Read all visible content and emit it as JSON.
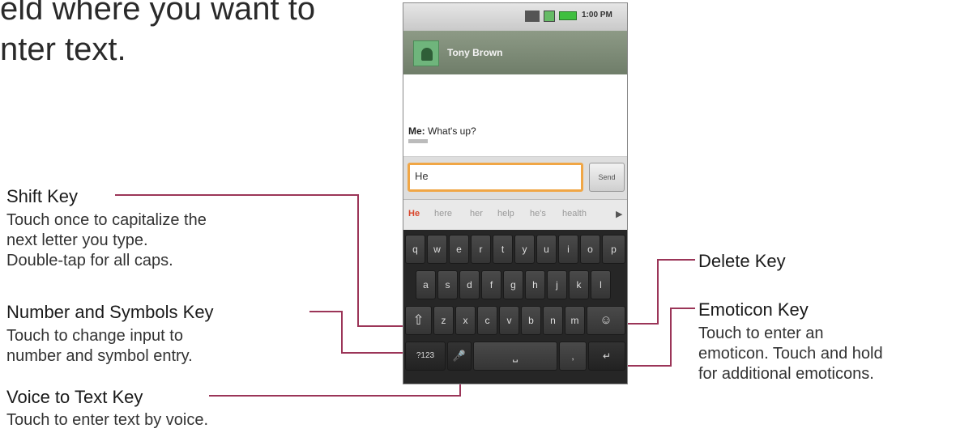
{
  "intro_text": "eld where you want to\nnter text.",
  "annotations": {
    "shift": {
      "title": "Shift Key",
      "desc": "Touch once to capitalize the\nnext letter you type.\nDouble-tap for all caps."
    },
    "number_symbols": {
      "title": "Number and Symbols Key",
      "desc": "Touch to change input to\nnumber and symbol entry."
    },
    "voice": {
      "title": "Voice to Text Key",
      "desc": "Touch to enter text by voice."
    },
    "delete": {
      "title": "Delete Key"
    },
    "emoticon": {
      "title": "Emoticon Key",
      "desc": "Touch to enter an\nemoticon. Touch and hold\nfor additional emoticons."
    }
  },
  "phone": {
    "status_time": "1:00 PM",
    "contact_name": "Tony Brown",
    "message": {
      "sender": "Me:",
      "text": "What's up?"
    },
    "input_value": "He",
    "send_label": "Send",
    "suggestions": [
      "He",
      "here",
      "her",
      "help",
      "he's",
      "health"
    ],
    "more_glyph": "▶",
    "keys": {
      "row1": [
        "q",
        "w",
        "e",
        "r",
        "t",
        "y",
        "u",
        "i",
        "o",
        "p"
      ],
      "row2": [
        "a",
        "s",
        "d",
        "f",
        "g",
        "h",
        "j",
        "k",
        "l"
      ],
      "row3": [
        "z",
        "x",
        "c",
        "v",
        "b",
        "n",
        "m"
      ],
      "shift_glyph": "⇧",
      "emoticon_glyph": "☺",
      "number_key": "?123",
      "mic_glyph": "🎤",
      "space_glyph": "⎵",
      "comma": ",",
      "enter_glyph": "↵"
    }
  },
  "colors": {
    "leader": "#9b3558",
    "input_border": "#f0a646",
    "suggestion_active": "#d9462b"
  }
}
